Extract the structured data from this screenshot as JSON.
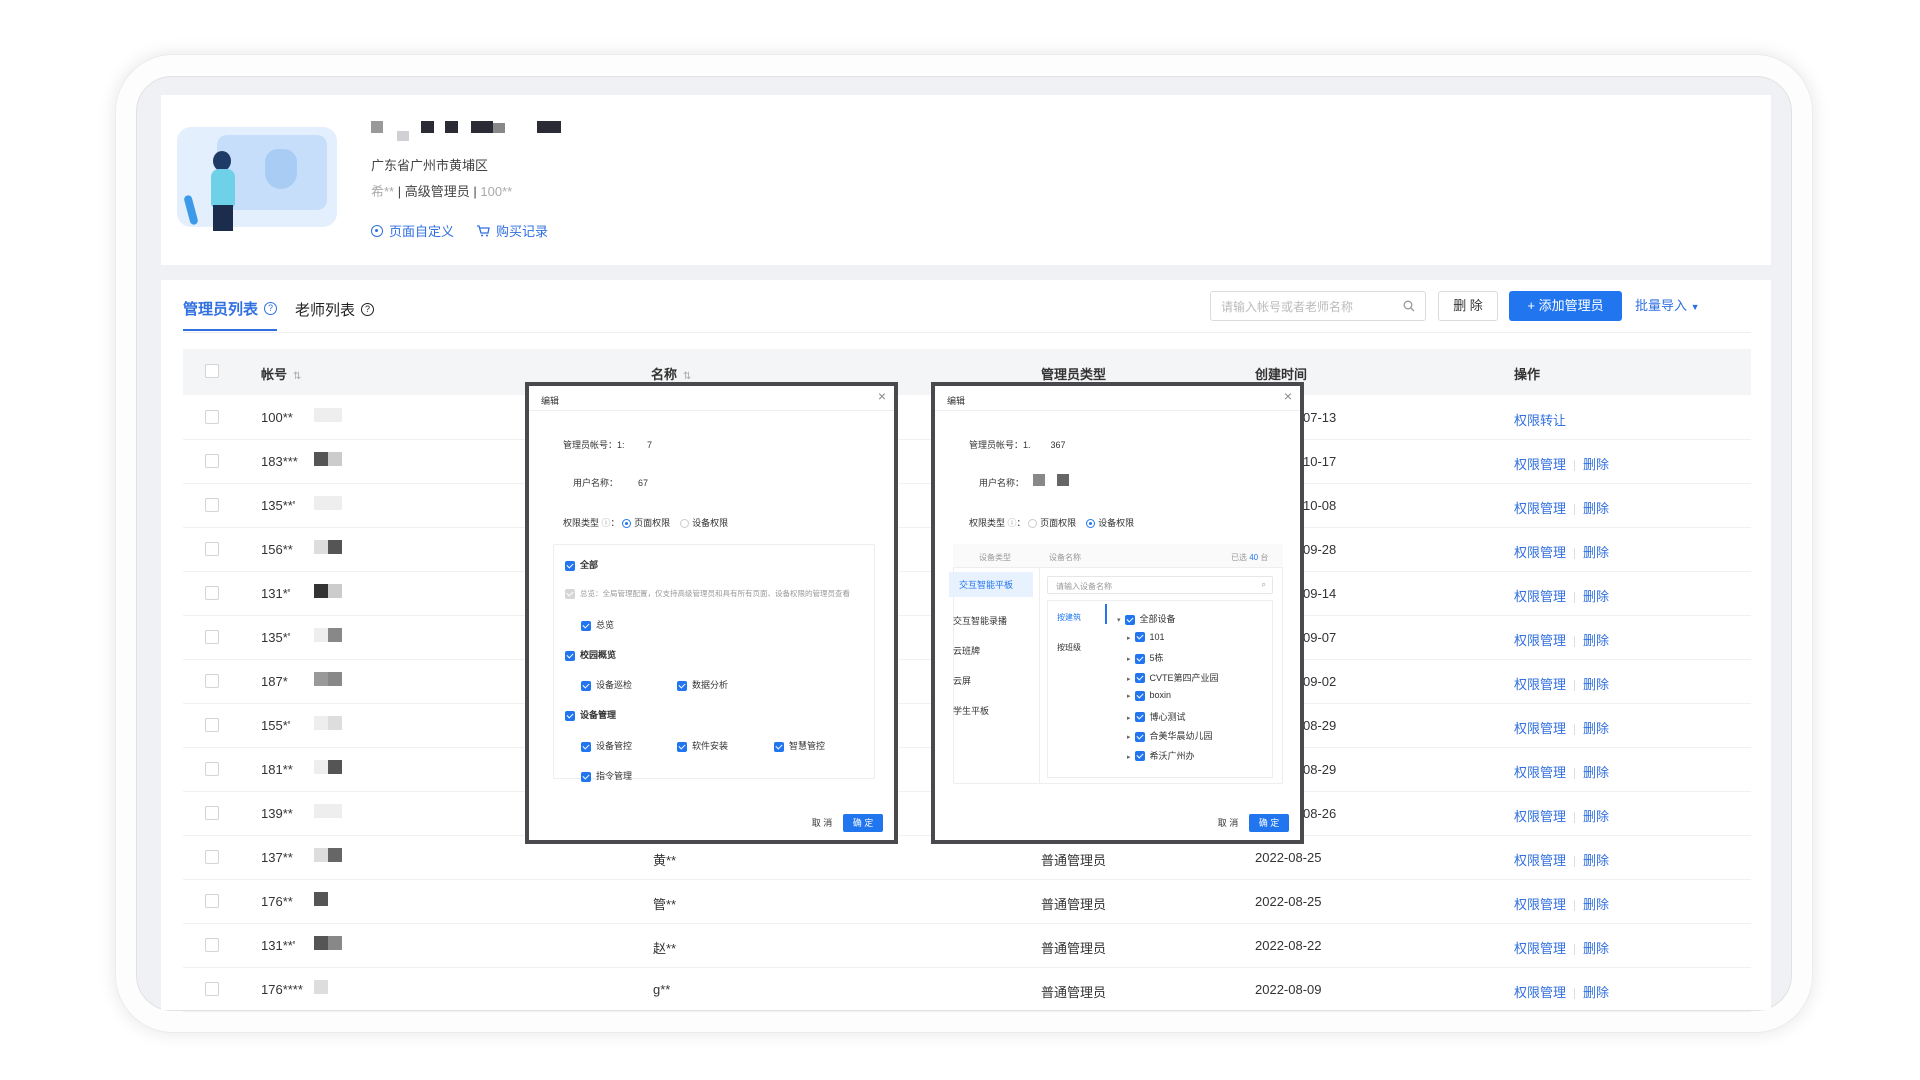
{
  "profile": {
    "address": "广东省广州市黄埔区",
    "account_masked": "希**",
    "role": "高级管理员",
    "id_masked": "100**",
    "link_customize": "页面自定义",
    "link_purchase": "购买记录"
  },
  "tabs": [
    {
      "label": "管理员列表"
    },
    {
      "label": "老师列表"
    }
  ],
  "toolbar": {
    "search_placeholder": "请输入帐号或者老师名称",
    "delete_label": "删 除",
    "add_label": "+ 添加管理员",
    "import_label": "批量导入"
  },
  "table": {
    "headers": {
      "account": "帐号",
      "name": "名称",
      "type": "管理员类型",
      "created": "创建时间",
      "ops": "操作"
    },
    "rows": [
      {
        "account": "100**",
        "date_tail": "07-13",
        "op1": "权限转让",
        "op2": ""
      },
      {
        "account": "183***",
        "date_tail": "10-17",
        "op1": "权限管理",
        "op2": "删除"
      },
      {
        "account": "135**'",
        "date_tail": "10-08",
        "op1": "权限管理",
        "op2": "删除"
      },
      {
        "account": "156**",
        "date_tail": "09-28",
        "op1": "权限管理",
        "op2": "删除"
      },
      {
        "account": "131*'",
        "date_tail": "09-14",
        "op1": "权限管理",
        "op2": "删除"
      },
      {
        "account": "135*'",
        "date_tail": "09-07",
        "op1": "权限管理",
        "op2": "删除"
      },
      {
        "account": "187*",
        "date_tail": "09-02",
        "op1": "权限管理",
        "op2": "删除"
      },
      {
        "account": "155*'",
        "date_tail": "08-29",
        "op1": "权限管理",
        "op2": "删除"
      },
      {
        "account": "181**",
        "date_tail": "08-29",
        "op1": "权限管理",
        "op2": "删除"
      },
      {
        "account": "139**",
        "date_tail": "08-26",
        "op1": "权限管理",
        "op2": "删除"
      },
      {
        "account": "137**",
        "name": "黄**",
        "type": "普通管理员",
        "date": "2022-08-25",
        "op1": "权限管理",
        "op2": "删除"
      },
      {
        "account": "176**",
        "name": "管**",
        "type": "普通管理员",
        "date": "2022-08-25",
        "op1": "权限管理",
        "op2": "删除"
      },
      {
        "account": "131**'",
        "name": "赵**",
        "type": "普通管理员",
        "date": "2022-08-22",
        "op1": "权限管理",
        "op2": "删除"
      },
      {
        "account": "176****",
        "name": "g**",
        "type": "普通管理员",
        "date": "2022-08-09",
        "op1": "权限管理",
        "op2": "删除"
      }
    ]
  },
  "dialog_page": {
    "title": "编辑",
    "account_label": "管理员帐号：",
    "account_value": "1:",
    "account_tail": "7",
    "username_label": "用户名称：",
    "username_tail": "67",
    "perm_type_label": "权限类型",
    "opt_page": "页面权限",
    "opt_device": "设备权限",
    "all": "全部",
    "overview_parent": "总览",
    "overview_note": "全局管理配置，仅支持高级管理员和具有所有页面、设备权限的管理员查看",
    "overview": "总览",
    "campus": "校园概览",
    "device_inspect": "设备巡检",
    "data_analysis": "数据分析",
    "device_mgmt": "设备管理",
    "device_control": "设备管控",
    "software_install": "软件安装",
    "smart_control": "智慧管控",
    "cmd_mgmt": "指令管理",
    "cancel": "取 消",
    "ok": "确 定"
  },
  "dialog_device": {
    "title": "编辑",
    "account_label": "管理员帐号：",
    "account_value": "1.",
    "account_tail": "367",
    "username_label": "用户名称：",
    "perm_type_label": "权限类型",
    "opt_page": "页面权限",
    "opt_device": "设备权限",
    "device_type_header": "设备类型",
    "device_name_header": "设备名称",
    "selected_prefix": "已选",
    "selected_count": "40",
    "selected_suffix": "台",
    "types": [
      "交互智能平板",
      "交互智能录播",
      "云班牌",
      "云屏",
      "学生平板"
    ],
    "search_placeholder": "请输入设备名称",
    "group_by_building": "按建筑",
    "group_by_class": "按班级",
    "tree": [
      "全部设备",
      "101",
      "5栋",
      "CVTE第四产业园",
      "boxin",
      "博心测试",
      "合美华晨幼儿园",
      "希沃广州办"
    ],
    "cancel": "取 消",
    "ok": "确 定"
  },
  "colors": {
    "primary": "#2176f0",
    "link": "#2f6fe0"
  }
}
